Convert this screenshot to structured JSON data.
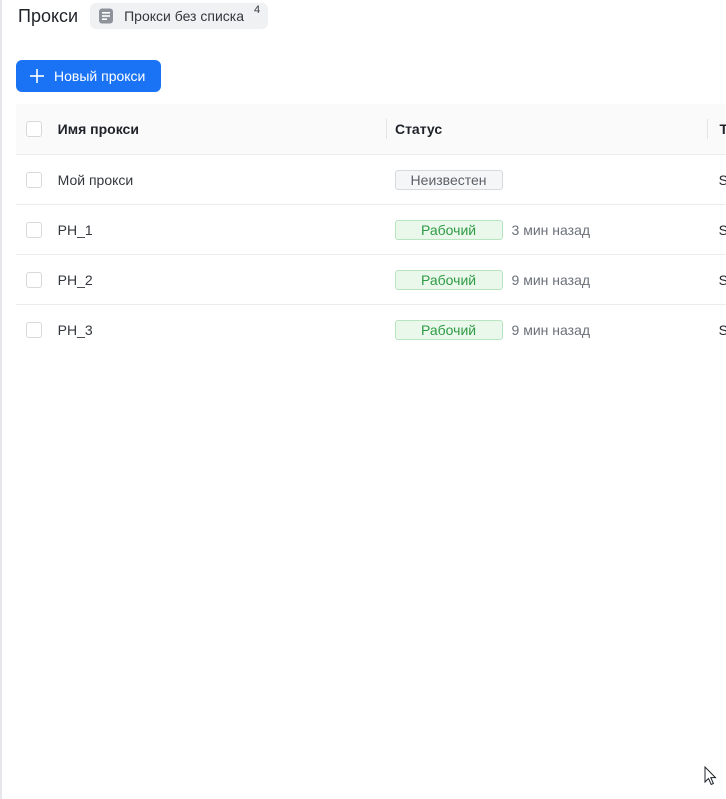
{
  "header": {
    "title": "Прокси",
    "list_chip": {
      "label": "Прокси без списка",
      "count": "4",
      "icon": "document-icon"
    }
  },
  "toolbar": {
    "new_proxy_label": "Новый прокси",
    "new_proxy_icon": "plus-icon"
  },
  "table": {
    "columns": {
      "name": "Имя прокси",
      "status": "Статус",
      "next": "Т"
    },
    "rows": [
      {
        "name": "Мой прокси",
        "status": "Неизвестен",
        "status_type": "unknown",
        "time": "",
        "next": "S"
      },
      {
        "name": "PH_1",
        "status": "Рабочий",
        "status_type": "ok",
        "time": "3 мин назад",
        "next": "S"
      },
      {
        "name": "PH_2",
        "status": "Рабочий",
        "status_type": "ok",
        "time": "9 мин назад",
        "next": "S"
      },
      {
        "name": "PH_3",
        "status": "Рабочий",
        "status_type": "ok",
        "time": "9 мин назад",
        "next": "S"
      }
    ]
  },
  "colors": {
    "accent": "#1a73f5",
    "status_ok": "#2f9a44",
    "status_unknown": "#5b6068"
  }
}
